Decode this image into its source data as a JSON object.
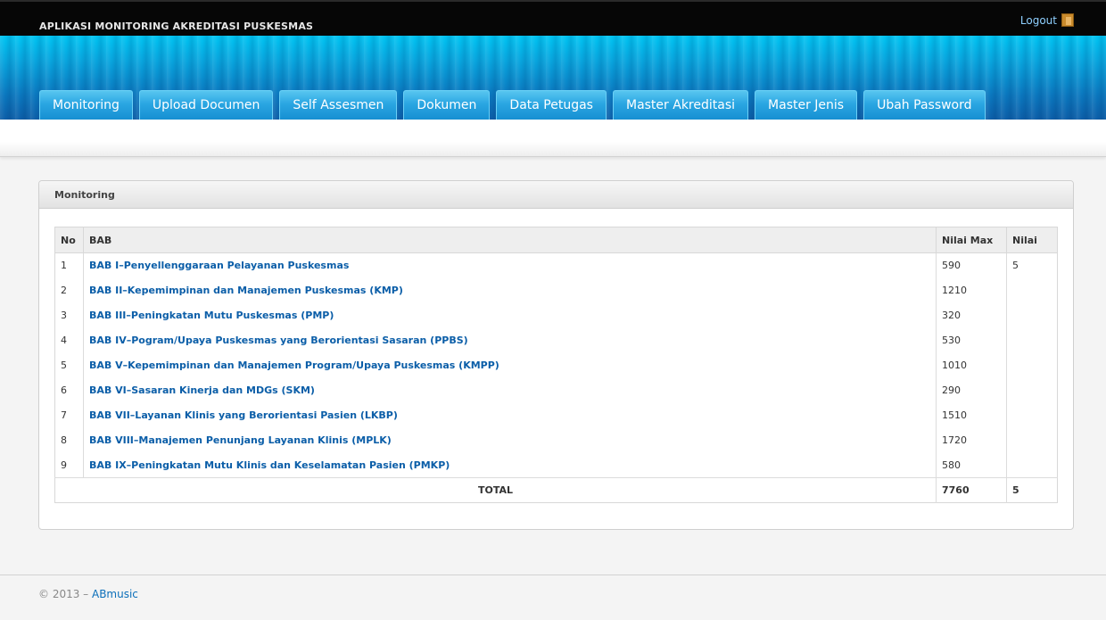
{
  "header": {
    "app_title": "APLIKASI MONITORING AKREDITASI PUSKESMAS",
    "logout_label": "Logout",
    "logout_icon": "door-icon"
  },
  "nav": {
    "items": [
      "Monitoring",
      "Upload Documen",
      "Self Assesmen",
      "Dokumen",
      "Data Petugas",
      "Master Akreditasi",
      "Master Jenis",
      "Ubah Password"
    ]
  },
  "panel": {
    "title": "Monitoring",
    "columns": [
      "No",
      "BAB",
      "Nilai Max",
      "Nilai"
    ],
    "rows": [
      {
        "no": "1",
        "bab": "BAB I–Penyellenggaraan Pelayanan Puskesmas",
        "max": "590",
        "nilai": "5"
      },
      {
        "no": "2",
        "bab": "BAB II–Kepemimpinan dan Manajemen Puskesmas (KMP)",
        "max": "1210",
        "nilai": ""
      },
      {
        "no": "3",
        "bab": "BAB III–Peningkatan Mutu Puskesmas (PMP)",
        "max": "320",
        "nilai": ""
      },
      {
        "no": "4",
        "bab": "BAB IV–Pogram/Upaya Puskesmas yang Berorientasi Sasaran (PPBS)",
        "max": "530",
        "nilai": ""
      },
      {
        "no": "5",
        "bab": "BAB V–Kepemimpinan dan Manajemen Program/Upaya Puskesmas (KMPP)",
        "max": "1010",
        "nilai": ""
      },
      {
        "no": "6",
        "bab": "BAB VI–Sasaran Kinerja dan MDGs (SKM)",
        "max": "290",
        "nilai": ""
      },
      {
        "no": "7",
        "bab": "BAB VII–Layanan Klinis yang Berorientasi Pasien (LKBP)",
        "max": "1510",
        "nilai": ""
      },
      {
        "no": "8",
        "bab": "BAB VIII–Manajemen Penunjang Layanan Klinis (MPLK)",
        "max": "1720",
        "nilai": ""
      },
      {
        "no": "9",
        "bab": "BAB IX–Peningkatan Mutu Klinis dan Keselamatan Pasien (PMKP)",
        "max": "580",
        "nilai": ""
      }
    ],
    "total": {
      "label": "TOTAL",
      "max": "7760",
      "nilai": "5"
    }
  },
  "footer": {
    "copyright": "© 2013 – ",
    "link": "ABmusic"
  },
  "colors": {
    "link": "#0b5ea8",
    "banner": "#0a78bf",
    "topbar": "#060606"
  }
}
